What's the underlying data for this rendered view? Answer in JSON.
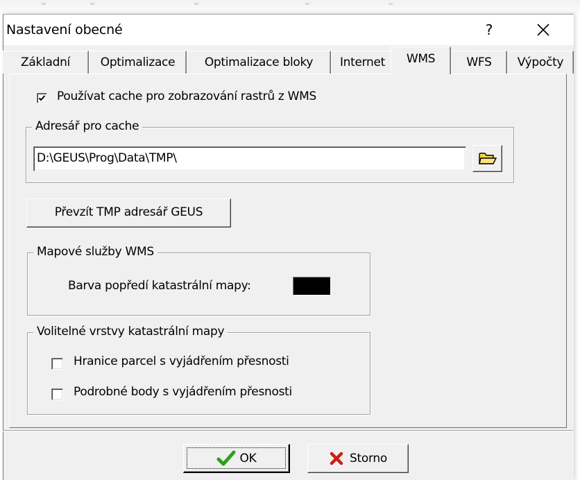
{
  "window": {
    "title": "Nastavení obecné",
    "help_label": "?"
  },
  "tabs": [
    {
      "label": "Základní",
      "active": false
    },
    {
      "label": "Optimalizace",
      "active": false
    },
    {
      "label": "Optimalizace bloky",
      "active": false
    },
    {
      "label": "Internet",
      "active": false
    },
    {
      "label": "WMS",
      "active": true
    },
    {
      "label": "WFS",
      "active": false
    },
    {
      "label": "Výpočty",
      "active": false
    }
  ],
  "wms": {
    "use_cache": {
      "label": "Používat cache pro zobrazování rastrů z WMS",
      "checked": true
    },
    "cache_dir": {
      "legend": "Adresář pro cache",
      "value": "D:\\GEUS\\Prog\\Data\\TMP\\",
      "browse_icon": "folder-open-icon"
    },
    "take_tmp_button": "Převzít TMP adresář GEUS",
    "map_services": {
      "legend": "Mapové služby WMS",
      "foreground_color_label": "Barva popředí katastrální mapy:",
      "foreground_color": "#000000"
    },
    "optional_layers": {
      "legend": "Volitelné vrstvy katastrální mapy",
      "items": [
        {
          "label": "Hranice parcel s vyjádřením přesnosti",
          "checked": false
        },
        {
          "label": "Podrobné body s vyjádřením přesnosti",
          "checked": false
        }
      ]
    }
  },
  "footer": {
    "ok_label": "OK",
    "cancel_label": "Storno",
    "ok_icon": "check-icon",
    "cancel_icon": "x-icon",
    "ok_icon_color": "#2f9e1e",
    "cancel_icon_color": "#cc1f10"
  }
}
